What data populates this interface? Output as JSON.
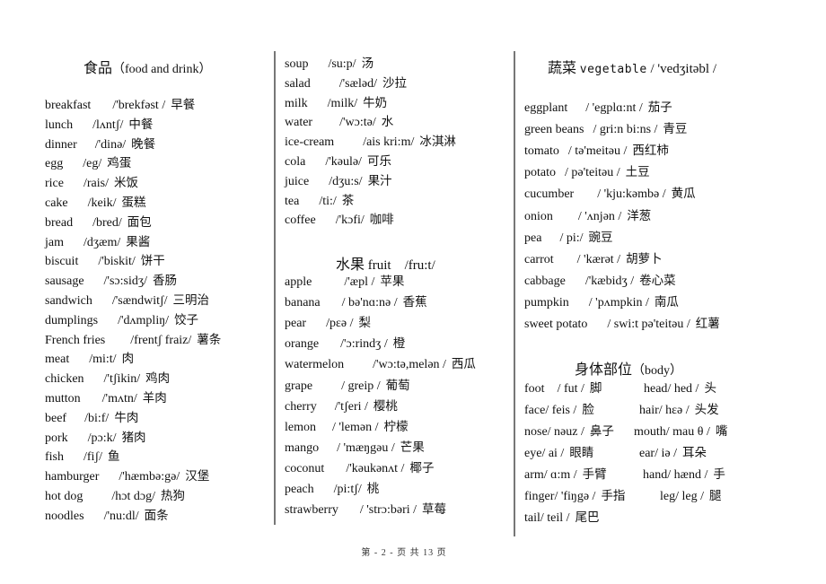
{
  "food": {
    "title_zh": "食品",
    "title_en": "（food and drink）",
    "items": [
      {
        "word": "breakfast",
        "ipa": "/'brekfəst /",
        "zh": "早餐"
      },
      {
        "word": "lunch",
        "ipa": "/lʌntʃ/",
        "zh": "中餐"
      },
      {
        "word": "dinner",
        "ipa": "/'dinə/",
        "zh": "晚餐"
      },
      {
        "word": "egg",
        "ipa": "/eg/",
        "zh": "鸡蛋"
      },
      {
        "word": "rice",
        "ipa": "/rais/",
        "zh": "米饭"
      },
      {
        "word": "cake",
        "ipa": "/keik/",
        "zh": "蛋糕"
      },
      {
        "word": "bread",
        "ipa": "/bred/",
        "zh": "面包"
      },
      {
        "word": "jam",
        "ipa": "/dʒæm/",
        "zh": "果酱"
      },
      {
        "word": "biscuit",
        "ipa": "/'biskit/",
        "zh": "饼干"
      },
      {
        "word": "sausage",
        "ipa": "/'sɔ:sidʒ/",
        "zh": "香肠"
      },
      {
        "word": "sandwich",
        "ipa": "/'sændwitʃ/",
        "zh": "三明治"
      },
      {
        "word": "dumplings",
        "ipa": "/'dʌmpliŋ/",
        "zh": "饺子"
      },
      {
        "word": "French fries",
        "ipa": "/frentʃ fraiz/",
        "zh": "薯条"
      },
      {
        "word": "meat",
        "ipa": "/mi:t/",
        "zh": "肉"
      },
      {
        "word": "chicken",
        "ipa": "/'tʃikin/",
        "zh": "鸡肉"
      },
      {
        "word": "mutton",
        "ipa": "/'mʌtn/",
        "zh": "羊肉"
      },
      {
        "word": "beef",
        "ipa": "/bi:f/",
        "zh": "牛肉"
      },
      {
        "word": "pork",
        "ipa": "/pɔ:k/",
        "zh": "猪肉"
      },
      {
        "word": "fish",
        "ipa": "/fiʃ/",
        "zh": "鱼"
      },
      {
        "word": "hamburger",
        "ipa": "/'hæmbə:gə/",
        "zh": "汉堡"
      },
      {
        "word": "hot dog",
        "ipa": "/hɔt dɔg/",
        "zh": "热狗"
      },
      {
        "word": "noodles",
        "ipa": "/'nu:dl/",
        "zh": "面条"
      }
    ]
  },
  "drinks": {
    "items": [
      {
        "word": "soup",
        "ipa": "/su:p/",
        "zh": "汤"
      },
      {
        "word": "salad",
        "ipa": "/'sæləd/",
        "zh": "沙拉"
      },
      {
        "word": "milk",
        "ipa": "/milk/",
        "zh": "牛奶"
      },
      {
        "word": "water",
        "ipa": "/'wɔ:tə/",
        "zh": "水"
      },
      {
        "word": "ice-cream",
        "ipa": "/ais kri:m/",
        "zh": "冰淇淋"
      },
      {
        "word": "cola",
        "ipa": "/'kəulə/",
        "zh": "可乐"
      },
      {
        "word": "juice",
        "ipa": "/dʒu:s/",
        "zh": "果汁"
      },
      {
        "word": "tea",
        "ipa": "/ti:/",
        "zh": "茶"
      },
      {
        "word": "coffee",
        "ipa": "/'kɔfi/",
        "zh": "咖啡"
      }
    ]
  },
  "fruit": {
    "title_zh": "水果",
    "title_en": "fruit",
    "title_ipa": "/fru:t/",
    "items": [
      {
        "word": "apple",
        "ipa": "/'æpl /",
        "zh": "苹果"
      },
      {
        "word": "banana",
        "ipa": "/ bə'nɑ:nə /",
        "zh": "香蕉"
      },
      {
        "word": "pear",
        "ipa": "/pɛə /",
        "zh": "梨"
      },
      {
        "word": "orange",
        "ipa": "/'ɔ:rindʒ /",
        "zh": "橙"
      },
      {
        "word": "watermelon",
        "ipa": "/'wɔ:tə,melən /",
        "zh": "西瓜"
      },
      {
        "word": "grape",
        "ipa": "/ greip /",
        "zh": "葡萄"
      },
      {
        "word": "cherry",
        "ipa": "/'tʃeri /",
        "zh": "樱桃"
      },
      {
        "word": "lemon",
        "ipa": "/ 'lemən /",
        "zh": "柠檬"
      },
      {
        "word": "mango",
        "ipa": "/ 'mæŋgəu /",
        "zh": "芒果"
      },
      {
        "word": "coconut",
        "ipa": "/'kəukənʌt /",
        "zh": "椰子"
      },
      {
        "word": "peach",
        "ipa": "/pi:tʃ/",
        "zh": "桃"
      },
      {
        "word": "strawberry",
        "ipa": "/ 'strɔ:bəri /",
        "zh": "草莓"
      }
    ]
  },
  "vegetable": {
    "title_zh": "蔬菜",
    "title_en": "vegetable",
    "title_ipa": "/ 'vedʒitəbl /",
    "items": [
      {
        "word": "eggplant",
        "ipa": "/ 'egplɑ:nt /",
        "zh": "茄子"
      },
      {
        "word": "green beans",
        "ipa": "/ gri:n bi:ns /",
        "zh": "青豆"
      },
      {
        "word": "tomato",
        "ipa": "/ tə'meitəu /",
        "zh": "西红柿"
      },
      {
        "word": "potato",
        "ipa": "/ pə'teitəu /",
        "zh": "土豆"
      },
      {
        "word": "cucumber",
        "ipa": "/ 'kju:kəmbə /",
        "zh": "黄瓜"
      },
      {
        "word": "onion",
        "ipa": "/ 'ʌnjən /",
        "zh": "洋葱"
      },
      {
        "word": "pea",
        "ipa": "/ pi:/",
        "zh": "豌豆"
      },
      {
        "word": "carrot",
        "ipa": "/ 'kærət /",
        "zh": "胡萝卜"
      },
      {
        "word": "cabbage",
        "ipa": "/'kæbidʒ /",
        "zh": "卷心菜"
      },
      {
        "word": "pumpkin",
        "ipa": "/ 'pʌmpkin /",
        "zh": "南瓜"
      },
      {
        "word": "sweet potato",
        "ipa": "/ swi:t pə'teitəu /",
        "zh": "红薯"
      }
    ]
  },
  "body": {
    "title_zh": "身体部位",
    "title_en": "（body）",
    "rows": [
      {
        "left": {
          "word": "foot",
          "ipa": "/ fut /",
          "zh": "脚"
        },
        "right": {
          "word": "head",
          "ipa": "/ hed /",
          "zh": "头"
        }
      },
      {
        "left": {
          "word": "face",
          "ipa": "/ feis /",
          "zh": "脸"
        },
        "right": {
          "word": "hair",
          "ipa": "/ hɛə /",
          "zh": "头发"
        }
      },
      {
        "left": {
          "word": "nose",
          "ipa": "/ nəuz /",
          "zh": "鼻子"
        },
        "right": {
          "word": "mouth",
          "ipa": "/ mau θ /",
          "zh": "嘴"
        }
      },
      {
        "left": {
          "word": "eye",
          "ipa": "/ ai /",
          "zh": "眼睛"
        },
        "right": {
          "word": "ear",
          "ipa": "/ iə /",
          "zh": "耳朵"
        }
      },
      {
        "left": {
          "word": "arm",
          "ipa": "/ ɑ:m /",
          "zh": "手臂"
        },
        "right": {
          "word": "hand",
          "ipa": "/ hænd /",
          "zh": "手"
        }
      },
      {
        "left": {
          "word": "finger",
          "ipa": "/ 'fiŋgə /",
          "zh": "手指"
        },
        "right": {
          "word": "leg",
          "ipa": "/ leg /",
          "zh": "腿"
        }
      },
      {
        "left": {
          "word": "tail",
          "ipa": "/ teil /",
          "zh": "尾巴"
        },
        "right": null
      }
    ]
  },
  "footer": {
    "text": "第 - 2 - 页 共 13 页"
  }
}
